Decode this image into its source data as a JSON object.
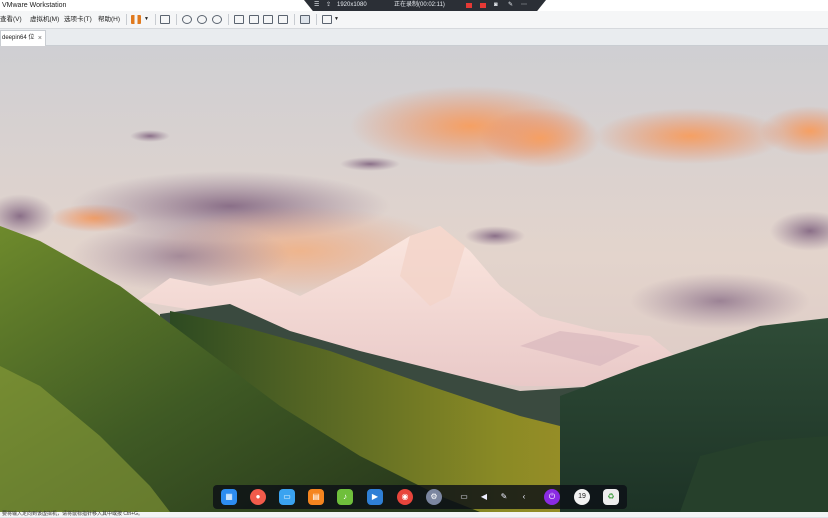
{
  "window": {
    "title": "VMware Workstation"
  },
  "remote_bar": {
    "resolution": "1920x1080",
    "recording_label": "正在录制",
    "recording_time": "(00:02:11)"
  },
  "menu": {
    "items": [
      "查看(V)",
      "虚拟机(M)",
      "选项卡(T)",
      "帮助(H)"
    ]
  },
  "tabs": [
    {
      "label": "deepin64 位",
      "close": "×"
    }
  ],
  "dock": {
    "apps": [
      {
        "name": "launcher",
        "color": "#2d8cf0",
        "glyph": "▦"
      },
      {
        "name": "screen-recorder",
        "color": "#f25b4b",
        "glyph": "●"
      },
      {
        "name": "file-manager",
        "color": "#3aa3f0",
        "glyph": "▭"
      },
      {
        "name": "app-store",
        "color": "#f5851f",
        "glyph": "▤"
      },
      {
        "name": "music",
        "color": "#6fbf3c",
        "glyph": "♪"
      },
      {
        "name": "video",
        "color": "#2f7fd6",
        "glyph": "▶"
      },
      {
        "name": "chrome",
        "color": "#e8453c",
        "glyph": "◉"
      },
      {
        "name": "settings",
        "color": "#7b86a0",
        "glyph": "⚙"
      }
    ],
    "tray": [
      {
        "name": "monitor",
        "glyph": "▭"
      },
      {
        "name": "volume",
        "glyph": "◀"
      },
      {
        "name": "pen",
        "glyph": "✎"
      },
      {
        "name": "collapse",
        "glyph": "‹"
      }
    ],
    "tray_apps": [
      {
        "name": "power",
        "color": "#8a2be2",
        "glyph": "⏻"
      },
      {
        "name": "clock",
        "color": "#f2f2f2",
        "glyph": "19"
      },
      {
        "name": "trash",
        "color": "#eeeeee",
        "glyph": "♻"
      }
    ]
  },
  "statusbar": {
    "text": "要将输入定向到该虚拟机，请将鼠标指针移入其中或按 Ctrl+G。"
  }
}
